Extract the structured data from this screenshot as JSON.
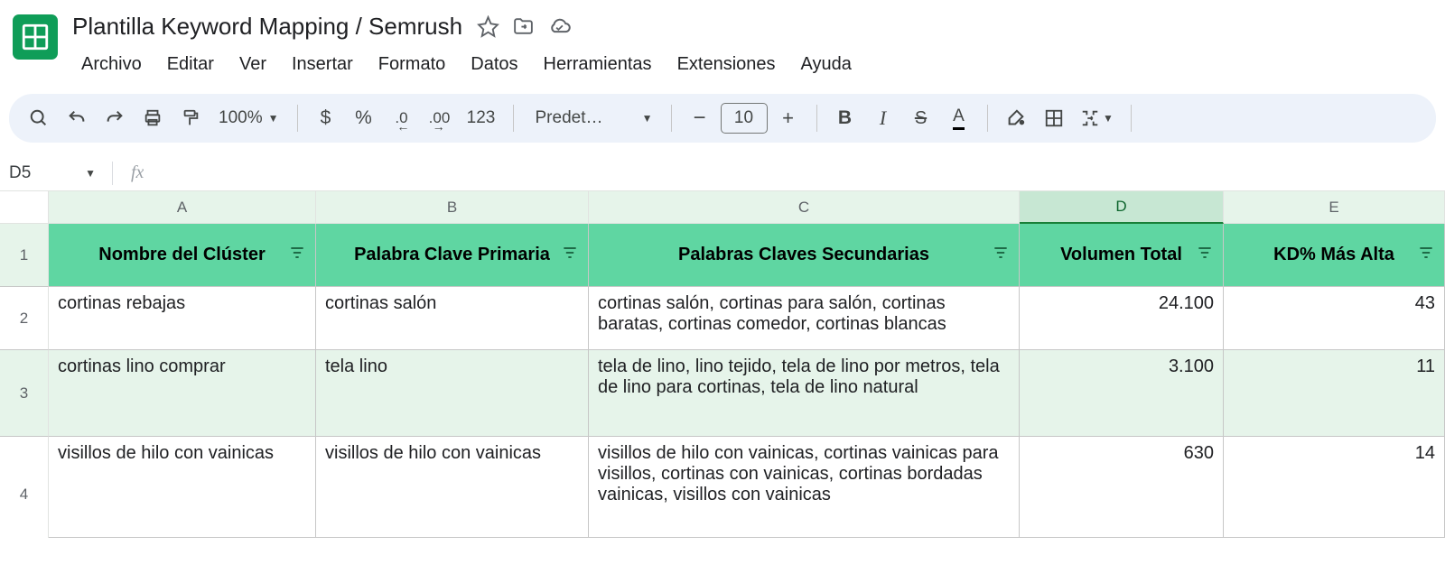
{
  "doc": {
    "title": "Plantilla Keyword Mapping / Semrush"
  },
  "menu": {
    "items": [
      "Archivo",
      "Editar",
      "Ver",
      "Insertar",
      "Formato",
      "Datos",
      "Herramientas",
      "Extensiones",
      "Ayuda"
    ]
  },
  "toolbar": {
    "zoom": "100%",
    "currency": "$",
    "percent": "%",
    "dec_dec": ".0",
    "dec_inc": ".00",
    "num_fmt": "123",
    "font": "Predet…",
    "font_size": "10"
  },
  "namebox": {
    "ref": "D5",
    "fx": "fx",
    "formula": ""
  },
  "grid": {
    "cols": [
      "A",
      "B",
      "C",
      "D",
      "E"
    ],
    "active_col_index": 3,
    "row_numbers": [
      "1",
      "2",
      "3",
      "4"
    ],
    "headers": [
      "Nombre del Clúster",
      "Palabra Clave Primaria",
      "Palabras Claves Secundarias",
      "Volumen Total",
      "KD% Más Alta"
    ],
    "rows": [
      {
        "cluster": "cortinas rebajas",
        "primary": "cortinas salón",
        "secondary": "cortinas salón, cortinas para salón, cortinas baratas, cortinas comedor, cortinas blancas",
        "volume": "24.100",
        "kd": "43"
      },
      {
        "cluster": "cortinas lino comprar",
        "primary": "tela lino",
        "secondary": "tela de lino, lino tejido, tela de lino por metros, tela de lino para cortinas, tela de lino natural",
        "volume": "3.100",
        "kd": "11"
      },
      {
        "cluster": "visillos de hilo con vainicas",
        "primary": "visillos de hilo con vainicas",
        "secondary": "visillos de hilo con vainicas, cortinas vainicas para visillos, cortinas con vainicas, cortinas bordadas vainicas, visillos con vainicas",
        "volume": "630",
        "kd": "14"
      }
    ]
  },
  "chart_data": {
    "type": "table",
    "columns": [
      "Nombre del Clúster",
      "Palabra Clave Primaria",
      "Palabras Claves Secundarias",
      "Volumen Total",
      "KD% Más Alta"
    ],
    "rows": [
      [
        "cortinas rebajas",
        "cortinas salón",
        "cortinas salón, cortinas para salón, cortinas baratas, cortinas comedor, cortinas blancas",
        24100,
        43
      ],
      [
        "cortinas lino comprar",
        "tela lino",
        "tela de lino, lino tejido, tela de lino por metros, tela de lino para cortinas, tela de lino natural",
        3100,
        11
      ],
      [
        "visillos de hilo con vainicas",
        "visillos de hilo con vainicas",
        "visillos de hilo con vainicas, cortinas vainicas para visillos, cortinas con vainicas, cortinas bordadas vainicas, visillos con vainicas",
        630,
        14
      ]
    ]
  }
}
